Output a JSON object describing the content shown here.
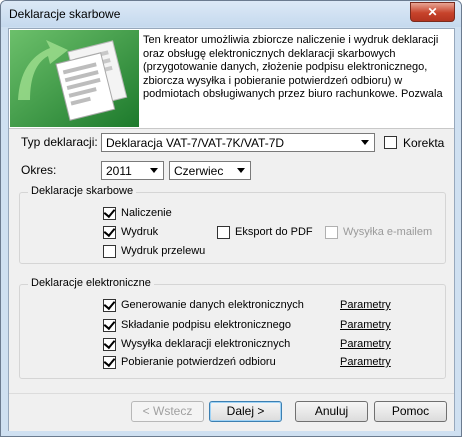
{
  "window": {
    "title": "Deklaracje skarbowe",
    "close_glyph": "✕"
  },
  "banner": {
    "icon": "documents-arrow-icon",
    "text": "Ten kreator umożliwia zbiorcze naliczenie i wydruk deklaracji oraz obsługę elektronicznych deklaracji skarbowych (przygotowanie danych, złożenie podpisu elektronicznego, zbiorcza wysyłka i pobieranie potwierdzeń odbioru) w podmiotach obsługiwanych przez biuro rachunkowe. Pozwala"
  },
  "form": {
    "type_label": "Typ deklaracji:",
    "type_value": "Deklaracja VAT-7/VAT-7K/VAT-7D",
    "korekta_label": "Korekta",
    "korekta_checked": false,
    "period_label": "Okres:",
    "year_value": "2011",
    "month_value": "Czerwiec"
  },
  "tax_group": {
    "title": "Deklaracje skarbowe",
    "naliczenie_label": "Naliczenie",
    "naliczenie_checked": true,
    "wydruk_label": "Wydruk",
    "wydruk_checked": true,
    "eksport_label": "Eksport do PDF",
    "eksport_checked": false,
    "email_label": "Wysyłka e-mailem",
    "email_checked": false,
    "przelew_label": "Wydruk przelewu",
    "przelew_checked": false
  },
  "edecl_group": {
    "title": "Deklaracje elektroniczne",
    "items": [
      {
        "label": "Generowanie danych elektronicznych",
        "checked": true,
        "link": "Parametry"
      },
      {
        "label": "Składanie podpisu elektronicznego",
        "checked": true,
        "link": "Parametry"
      },
      {
        "label": "Wysyłka deklaracji elektronicznych",
        "checked": true,
        "link": "Parametry"
      },
      {
        "label": "Pobieranie potwierdzeń odbioru",
        "checked": true,
        "link": "Parametry"
      }
    ]
  },
  "buttons": {
    "back": "< Wstecz",
    "next": "Dalej >",
    "cancel": "Anuluj",
    "help": "Pomoc"
  }
}
